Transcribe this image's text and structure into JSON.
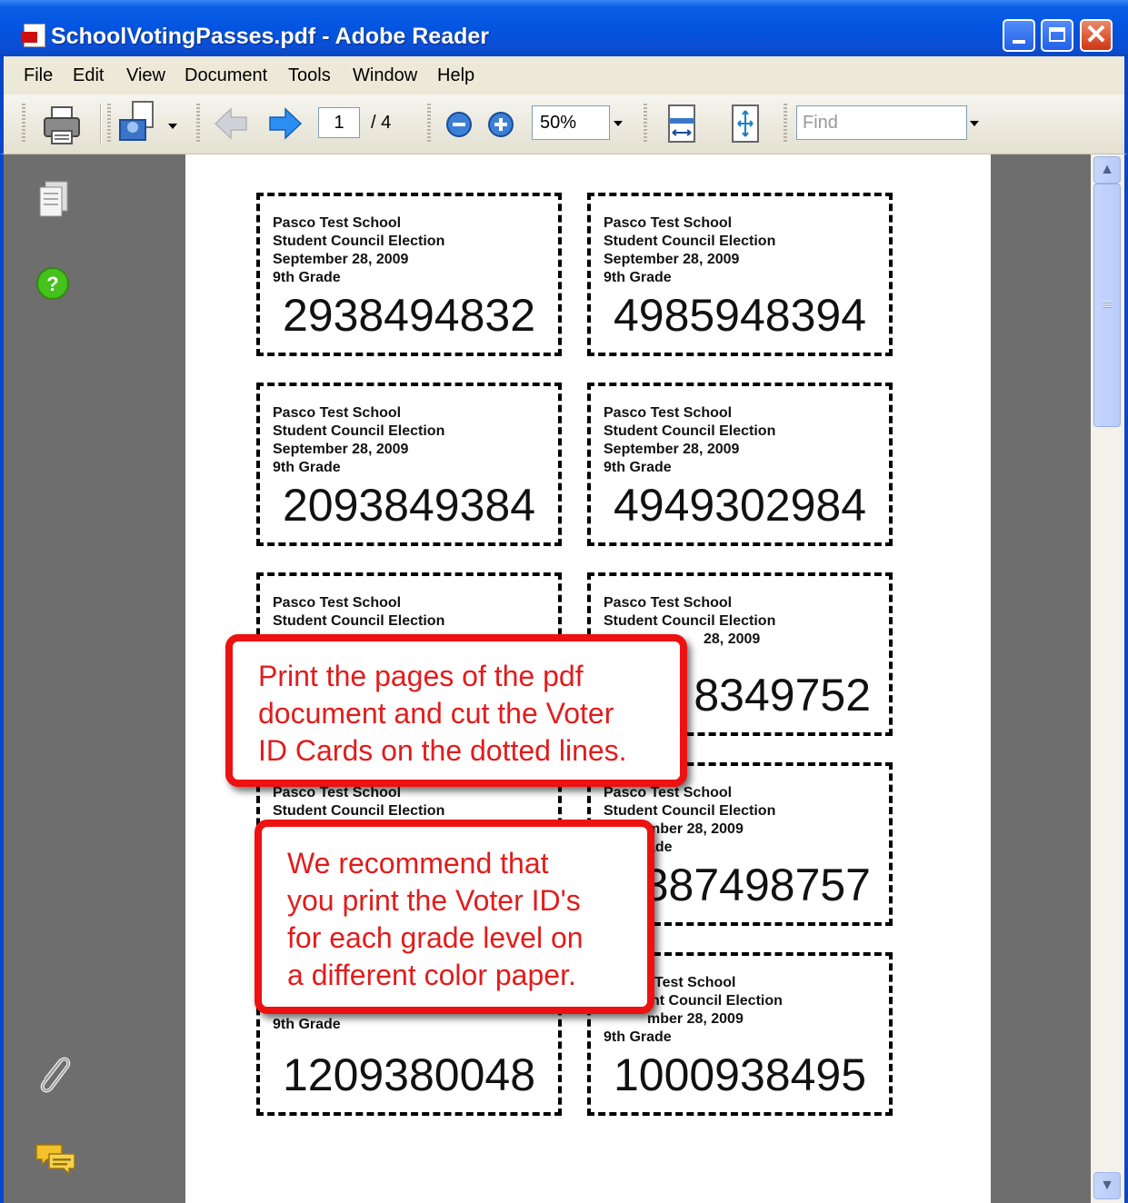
{
  "window": {
    "title": "SchoolVotingPasses.pdf - Adobe Reader",
    "buttons": {
      "close_glyph": "✕"
    }
  },
  "menu": {
    "items": [
      "File",
      "Edit",
      "View",
      "Document",
      "Tools",
      "Window",
      "Help"
    ]
  },
  "toolbar": {
    "page_current": "1",
    "page_total": "/ 4",
    "zoom": "50%",
    "find_placeholder": "Find",
    "icons": [
      "print-icon",
      "email-icon",
      "previous-page-icon",
      "next-page-icon",
      "zoom-out-icon",
      "zoom-in-icon",
      "fit-width-icon",
      "fit-page-icon"
    ]
  },
  "side_panel": {
    "icons": [
      "pages-icon",
      "help-icon",
      "attachment-icon",
      "comments-icon"
    ]
  },
  "document": {
    "cards": [
      {
        "school": "Pasco Test School",
        "election": "Student Council Election",
        "date": "September 28, 2009",
        "grade": "9th Grade",
        "number": "2938494832"
      },
      {
        "school": "Pasco Test School",
        "election": "Student Council Election",
        "date": "September 28, 2009",
        "grade": "9th Grade",
        "number": "4985948394"
      },
      {
        "school": "Pasco Test School",
        "election": "Student Council Election",
        "date": "September 28, 2009",
        "grade": "9th Grade",
        "number": "2093849384"
      },
      {
        "school": "Pasco Test School",
        "election": "Student Council Election",
        "date": "September 28, 2009",
        "grade": "9th Grade",
        "number": "4949302984"
      },
      {
        "school": "Pasco Test School",
        "election": "Student Council Election",
        "date": "",
        "grade": "",
        "number": ""
      },
      {
        "school": "Pasco Test School",
        "election": "Student Council Election",
        "date": "28, 2009",
        "grade": "",
        "number": "8349752"
      },
      {
        "school": "Pasco Test School",
        "election": "Student Council Election",
        "date": "",
        "grade": "",
        "number": ""
      },
      {
        "school": "Pasco Test School",
        "election": "Student Council Election",
        "date": "mber 28, 2009",
        "grade": "ade",
        "number": "387498757"
      },
      {
        "school": "",
        "election": "",
        "date": "",
        "grade": "9th Grade",
        "number": "1209380048"
      },
      {
        "school": "Test School",
        "election": "nt Council Election",
        "date": "mber 28, 2009",
        "grade": "9th Grade",
        "number": "1000938495"
      }
    ]
  },
  "callouts": [
    {
      "lines": [
        "Print the pages of the pdf",
        "document and cut the Voter",
        "ID Cards on the dotted lines."
      ]
    },
    {
      "lines": [
        "We recommend that",
        "you print the Voter ID's",
        "for each grade level on",
        "a different color paper."
      ]
    }
  ],
  "colors": {
    "title_bar": "#0354e0",
    "callout_border": "#ee1111",
    "callout_text": "#e21c1c",
    "panel_gray": "#6e6e6e"
  }
}
